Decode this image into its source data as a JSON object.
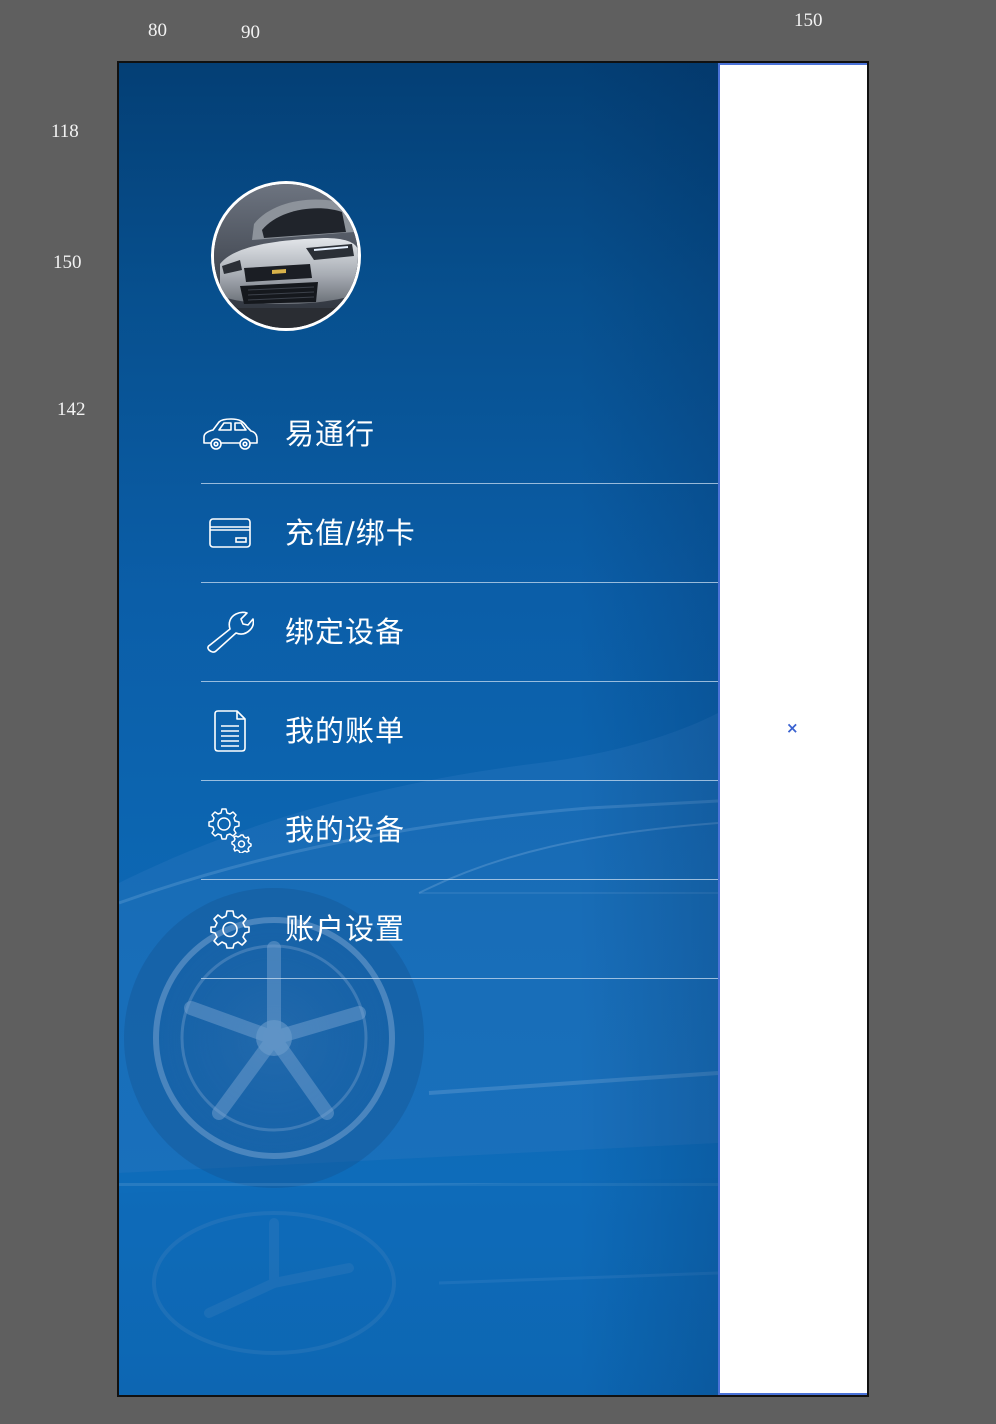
{
  "annotations": {
    "top_left_width": "80",
    "top_mid_width": "90",
    "top_right_width": "150",
    "left_top_gap": "118",
    "left_avatar_height": "150",
    "left_menu_gap": "142"
  },
  "drawer": {
    "avatar_alt": "car avatar",
    "menu": [
      {
        "label": "易通行",
        "icon": "car-icon"
      },
      {
        "label": "充值/绑卡",
        "icon": "card-icon"
      },
      {
        "label": "绑定设备",
        "icon": "wrench-icon"
      },
      {
        "label": "我的账单",
        "icon": "document-icon"
      },
      {
        "label": "我的设备",
        "icon": "gears-icon"
      },
      {
        "label": "账户设置",
        "icon": "gear-icon"
      }
    ]
  },
  "right_panel": {
    "close_symbol": "×"
  },
  "colors": {
    "drawer_top": "#043f75",
    "drawer_bottom": "#0d65b0",
    "divider": "#c8dcf0",
    "panel_border": "#4a72d8",
    "background": "#5f5f5f"
  }
}
